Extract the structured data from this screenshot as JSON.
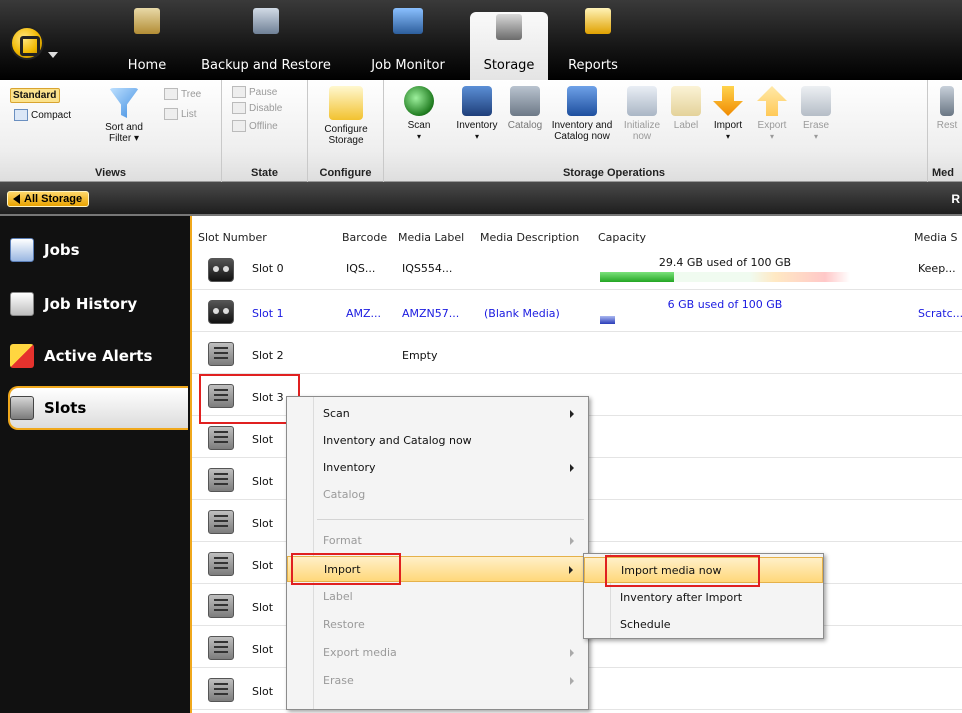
{
  "tabs": {
    "home": "Home",
    "backup": "Backup and Restore",
    "jobmonitor": "Job Monitor",
    "storage": "Storage",
    "reports": "Reports"
  },
  "ribbon": {
    "views": {
      "title": "Views",
      "standard": "Standard",
      "compact": "Compact",
      "sort_filter_1": "Sort and",
      "sort_filter_2": "Filter",
      "tree": "Tree",
      "list": "List"
    },
    "state": {
      "title": "State",
      "pause": "Pause",
      "disable": "Disable",
      "offline": "Offline"
    },
    "configure": {
      "title": "Configure",
      "btn_1": "Configure",
      "btn_2": "Storage"
    },
    "ops": {
      "title": "Storage Operations",
      "scan": "Scan",
      "inventory": "Inventory",
      "catalog": "Catalog",
      "inv_cat_1": "Inventory and",
      "inv_cat_2": "Catalog now",
      "init_1": "Initialize",
      "init_2": "now",
      "label": "Label",
      "import": "Import",
      "export": "Export",
      "erase": "Erase"
    },
    "media": {
      "title": "Med",
      "rest": "Rest"
    }
  },
  "breadcrumb": {
    "all_storage": "All Storage",
    "right": "R"
  },
  "nav": {
    "jobs": "Jobs",
    "history": "Job History",
    "alerts": "Active Alerts",
    "slots": "Slots"
  },
  "columns": {
    "slot": "Slot Number",
    "barcode": "Barcode",
    "media_label": "Media Label",
    "media_desc": "Media Description",
    "capacity": "Capacity",
    "media_s": "Media S"
  },
  "rows": [
    {
      "slot": "Slot 0",
      "barcode": "IQS...",
      "label": "IQS554...",
      "desc": "",
      "capacity": "29.4 GB used of 100 GB",
      "used_fraction": 0.294,
      "media": "Keep..."
    },
    {
      "slot": "Slot 1",
      "barcode": "AMZ...",
      "label": "AMZN57...",
      "desc": "(Blank Media)",
      "capacity": "6 GB used of 100 GB",
      "used_fraction": 0.06,
      "media": "Scratc..."
    },
    {
      "slot": "Slot 2",
      "label": "Empty"
    },
    {
      "slot": "Slot 3"
    },
    {
      "slot": "Slot"
    },
    {
      "slot": "Slot"
    },
    {
      "slot": "Slot"
    },
    {
      "slot": "Slot"
    },
    {
      "slot": "Slot"
    },
    {
      "slot": "Slot"
    },
    {
      "slot": "Slot"
    }
  ],
  "context_menu": {
    "scan": "Scan",
    "inv_cat": "Inventory and Catalog now",
    "inventory": "Inventory",
    "catalog": "Catalog",
    "format": "Format",
    "import": "Import",
    "label": "Label",
    "restore": "Restore",
    "export": "Export media",
    "erase": "Erase"
  },
  "import_submenu": {
    "now": "Import media now",
    "after": "Inventory after Import",
    "schedule": "Schedule"
  }
}
